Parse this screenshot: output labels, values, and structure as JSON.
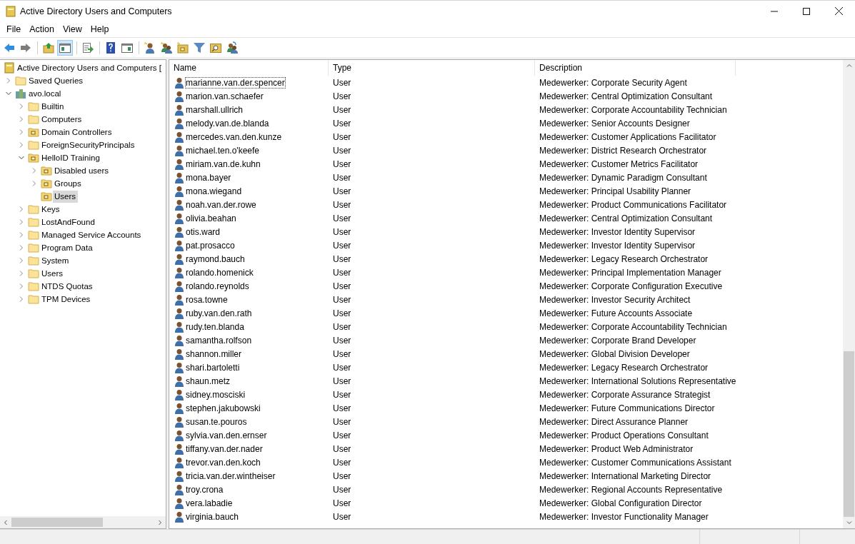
{
  "window": {
    "title": "Active Directory Users and Computers"
  },
  "menu": [
    "File",
    "Action",
    "View",
    "Help"
  ],
  "toolbar": [
    {
      "kind": "back",
      "pressed": false
    },
    {
      "kind": "forward",
      "pressed": false
    },
    {
      "kind": "sep"
    },
    {
      "kind": "up",
      "pressed": false
    },
    {
      "kind": "tree",
      "pressed": true
    },
    {
      "kind": "sep"
    },
    {
      "kind": "export",
      "pressed": false
    },
    {
      "kind": "sep"
    },
    {
      "kind": "help",
      "pressed": false
    },
    {
      "kind": "pane",
      "pressed": false
    },
    {
      "kind": "sep"
    },
    {
      "kind": "user",
      "pressed": false
    },
    {
      "kind": "group",
      "pressed": false
    },
    {
      "kind": "ou",
      "pressed": false
    },
    {
      "kind": "filter",
      "pressed": false
    },
    {
      "kind": "find",
      "pressed": false
    },
    {
      "kind": "move",
      "pressed": false
    }
  ],
  "tree": [
    {
      "label": "Active Directory Users and Computers [",
      "kind": "root",
      "selected": false,
      "children": [
        {
          "label": "Saved Queries",
          "kind": "folder",
          "selected": false,
          "expanded": false
        },
        {
          "label": "avo.local",
          "kind": "domain",
          "selected": false,
          "expanded": true,
          "children": [
            {
              "label": "Builtin",
              "kind": "folder",
              "selected": false,
              "expanded": false
            },
            {
              "label": "Computers",
              "kind": "folder",
              "selected": false,
              "expanded": false
            },
            {
              "label": "Domain Controllers",
              "kind": "ou",
              "selected": false,
              "expanded": false
            },
            {
              "label": "ForeignSecurityPrincipals",
              "kind": "folder",
              "selected": false,
              "expanded": false
            },
            {
              "label": "HelloID Training",
              "kind": "ou",
              "selected": false,
              "expanded": true,
              "children": [
                {
                  "label": "Disabled users",
                  "kind": "ou",
                  "selected": false,
                  "expanded": false
                },
                {
                  "label": "Groups",
                  "kind": "ou",
                  "selected": false,
                  "expanded": false
                },
                {
                  "label": "Users",
                  "kind": "ou",
                  "selected": true
                }
              ]
            },
            {
              "label": "Keys",
              "kind": "folder",
              "selected": false,
              "expanded": false
            },
            {
              "label": "LostAndFound",
              "kind": "folder",
              "selected": false,
              "expanded": false
            },
            {
              "label": "Managed Service Accounts",
              "kind": "folder",
              "selected": false,
              "expanded": false
            },
            {
              "label": "Program Data",
              "kind": "folder",
              "selected": false,
              "expanded": false
            },
            {
              "label": "System",
              "kind": "folder",
              "selected": false,
              "expanded": false
            },
            {
              "label": "Users",
              "kind": "folder",
              "selected": false,
              "expanded": false
            },
            {
              "label": "NTDS Quotas",
              "kind": "folder",
              "selected": false,
              "expanded": false
            },
            {
              "label": "TPM Devices",
              "kind": "folder",
              "selected": false,
              "expanded": false
            }
          ]
        }
      ]
    }
  ],
  "table": {
    "columns": [
      "Name",
      "Type",
      "Description"
    ],
    "rows": [
      {
        "name": "marianne.van.der.spencer",
        "type": "User",
        "description": "Medewerker: Corporate Security Agent",
        "focused": true
      },
      {
        "name": "marion.van.schaefer",
        "type": "User",
        "description": "Medewerker: Central Optimization Consultant",
        "focused": false
      },
      {
        "name": "marshall.ullrich",
        "type": "User",
        "description": "Medewerker: Corporate Accountability Technician",
        "focused": false
      },
      {
        "name": "melody.van.de.blanda",
        "type": "User",
        "description": "Medewerker: Senior Accounts Designer",
        "focused": false
      },
      {
        "name": "mercedes.van.den.kunze",
        "type": "User",
        "description": "Medewerker: Customer Applications Facilitator",
        "focused": false
      },
      {
        "name": "michael.ten.o'keefe",
        "type": "User",
        "description": "Medewerker: District Research Orchestrator",
        "focused": false
      },
      {
        "name": "miriam.van.de.kuhn",
        "type": "User",
        "description": "Medewerker: Customer Metrics Facilitator",
        "focused": false
      },
      {
        "name": "mona.bayer",
        "type": "User",
        "description": "Medewerker: Dynamic Paradigm Consultant",
        "focused": false
      },
      {
        "name": "mona.wiegand",
        "type": "User",
        "description": "Medewerker: Principal Usability Planner",
        "focused": false
      },
      {
        "name": "noah.van.der.rowe",
        "type": "User",
        "description": "Medewerker: Product Communications Facilitator",
        "focused": false
      },
      {
        "name": "olivia.beahan",
        "type": "User",
        "description": "Medewerker: Central Optimization Consultant",
        "focused": false
      },
      {
        "name": "otis.ward",
        "type": "User",
        "description": "Medewerker: Investor Identity Supervisor",
        "focused": false
      },
      {
        "name": "pat.prosacco",
        "type": "User",
        "description": "Medewerker: Investor Identity Supervisor",
        "focused": false
      },
      {
        "name": "raymond.bauch",
        "type": "User",
        "description": "Medewerker: Legacy Research Orchestrator",
        "focused": false
      },
      {
        "name": "rolando.homenick",
        "type": "User",
        "description": "Medewerker: Principal Implementation Manager",
        "focused": false
      },
      {
        "name": "rolando.reynolds",
        "type": "User",
        "description": "Medewerker: Corporate Configuration Executive",
        "focused": false
      },
      {
        "name": "rosa.towne",
        "type": "User",
        "description": "Medewerker: Investor Security Architect",
        "focused": false
      },
      {
        "name": "ruby.van.den.rath",
        "type": "User",
        "description": "Medewerker: Future Accounts Associate",
        "focused": false
      },
      {
        "name": "rudy.ten.blanda",
        "type": "User",
        "description": "Medewerker: Corporate Accountability Technician",
        "focused": false
      },
      {
        "name": "samantha.rolfson",
        "type": "User",
        "description": "Medewerker: Corporate Brand Developer",
        "focused": false
      },
      {
        "name": "shannon.miller",
        "type": "User",
        "description": "Medewerker: Global Division Developer",
        "focused": false
      },
      {
        "name": "shari.bartoletti",
        "type": "User",
        "description": "Medewerker: Legacy Research Orchestrator",
        "focused": false
      },
      {
        "name": "shaun.metz",
        "type": "User",
        "description": "Medewerker: International Solutions Representative",
        "focused": false
      },
      {
        "name": "sidney.mosciski",
        "type": "User",
        "description": "Medewerker: Corporate Assurance Strategist",
        "focused": false
      },
      {
        "name": "stephen.jakubowski",
        "type": "User",
        "description": "Medewerker: Future Communications Director",
        "focused": false
      },
      {
        "name": "susan.te.pouros",
        "type": "User",
        "description": "Medewerker: Direct Assurance Planner",
        "focused": false
      },
      {
        "name": "sylvia.van.den.ernser",
        "type": "User",
        "description": "Medewerker: Product Operations Consultant",
        "focused": false
      },
      {
        "name": "tiffany.van.der.nader",
        "type": "User",
        "description": "Medewerker: Product Web Administrator",
        "focused": false
      },
      {
        "name": "trevor.van.den.koch",
        "type": "User",
        "description": "Medewerker: Customer Communications Assistant",
        "focused": false
      },
      {
        "name": "tricia.van.der.wintheiser",
        "type": "User",
        "description": "Medewerker: International Marketing Director",
        "focused": false
      },
      {
        "name": "troy.crona",
        "type": "User",
        "description": "Medewerker: Regional Accounts Representative",
        "focused": false
      },
      {
        "name": "vera.labadie",
        "type": "User",
        "description": "Medewerker: Global Configuration Director",
        "focused": false
      },
      {
        "name": "virginia.bauch",
        "type": "User",
        "description": "Medewerker: Investor Functionality Manager",
        "focused": false
      }
    ]
  }
}
